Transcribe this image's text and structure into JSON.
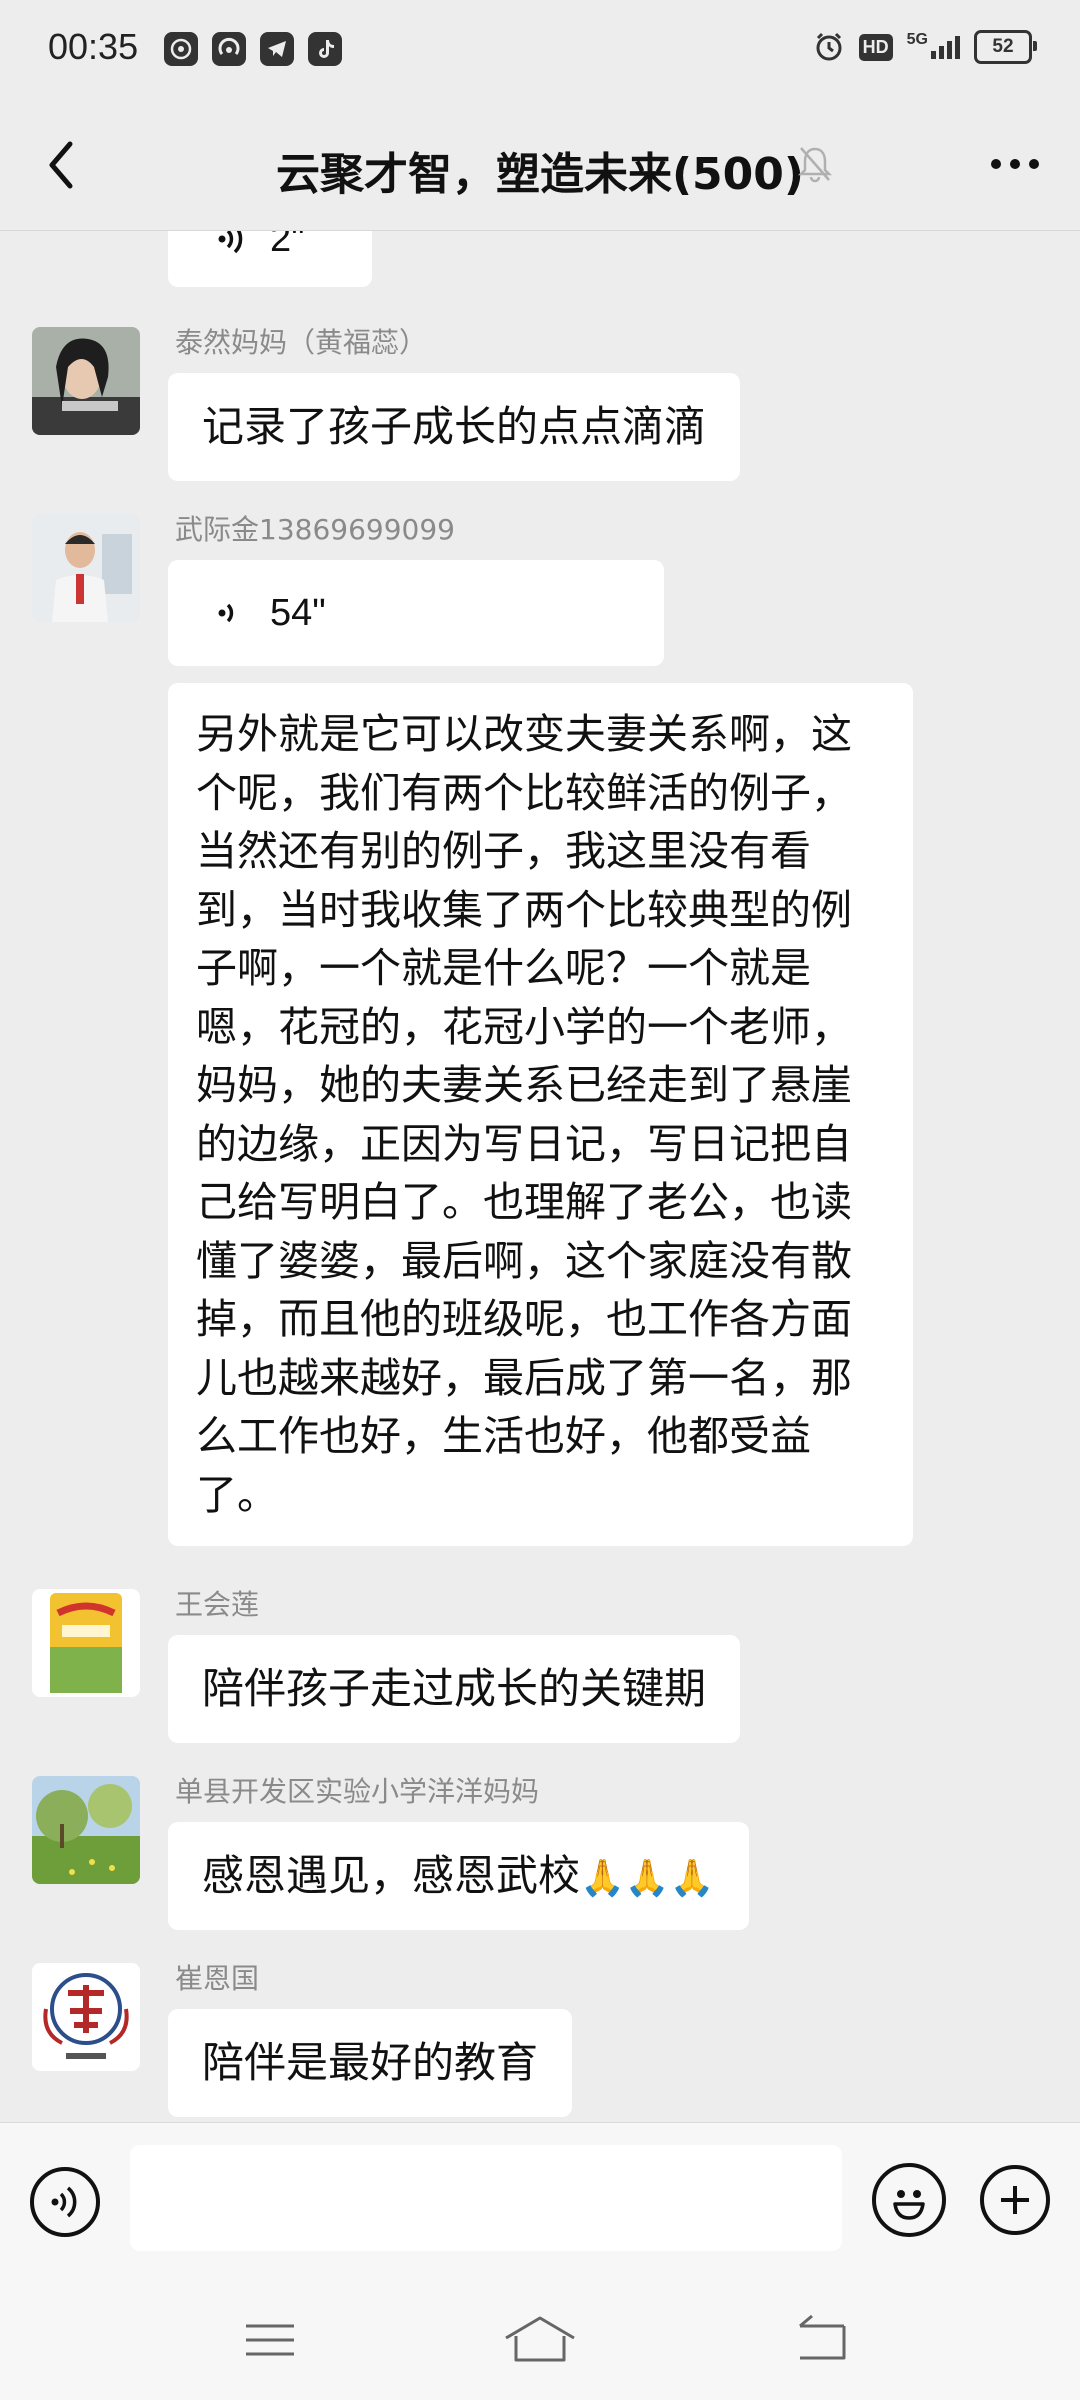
{
  "status_bar": {
    "time": "00:35",
    "hd": "HD",
    "network": "5G",
    "battery": "52"
  },
  "header": {
    "title": "云聚才智，塑造未来(500)"
  },
  "messages": [
    {
      "voice_duration": "2\""
    },
    {
      "sender": "泰然妈妈（黄福蕊）",
      "text": "记录了孩子成长的点点滴滴"
    },
    {
      "sender": "武际金13869699099",
      "voice_duration": "54\"",
      "text": "另外就是它可以改变夫妻关系啊，这个呢，我们有两个比较鲜活的例子，当然还有别的例子，我这里没有看到，当时我收集了两个比较典型的例子啊，一个就是什么呢？一个就是嗯，花冠的，花冠小学的一个老师，妈妈，她的夫妻关系已经走到了悬崖的边缘，正因为写日记，写日记把自己给写明白了。也理解了老公，也读懂了婆婆，最后啊，这个家庭没有散掉，而且他的班级呢，也工作各方面儿也越来越好，最后成了第一名，那么工作也好，生活也好，他都受益了。"
    },
    {
      "sender": "王会莲",
      "text": "陪伴孩子走过成长的关键期"
    },
    {
      "sender": "单县开发区实验小学洋洋妈妈",
      "text": "感恩遇见，感恩武校",
      "emoji": "🙏🙏🙏"
    },
    {
      "sender": "崔恩国",
      "text": "陪伴是最好的教育"
    }
  ],
  "colors": {
    "background": "#EDEDED",
    "bubble": "#FFFFFF",
    "sender_name": "#8A8A8A"
  },
  "icons": [
    "back-arrow-icon",
    "mute-bell-icon",
    "more-icon",
    "voice-icon",
    "emoji-icon",
    "plus-icon",
    "menu-icon",
    "home-icon",
    "back-icon"
  ]
}
